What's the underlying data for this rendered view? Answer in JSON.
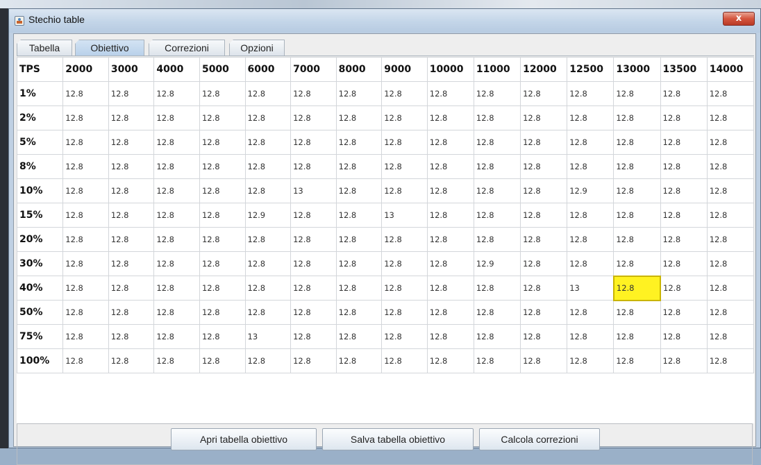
{
  "window": {
    "title": "Stechio table",
    "close_glyph": "x"
  },
  "tabs": [
    {
      "label": "Tabella",
      "selected": false
    },
    {
      "label": "Obiettivo",
      "selected": true
    },
    {
      "label": "Correzioni",
      "selected": false
    },
    {
      "label": "Opzioni",
      "selected": false
    }
  ],
  "table": {
    "corner_label": "TPS",
    "columns": [
      "2000",
      "3000",
      "4000",
      "5000",
      "6000",
      "7000",
      "8000",
      "9000",
      "10000",
      "11000",
      "12000",
      "12500",
      "13000",
      "13500",
      "14000"
    ],
    "rows": [
      {
        "label": "1%",
        "values": [
          "12.8",
          "12.8",
          "12.8",
          "12.8",
          "12.8",
          "12.8",
          "12.8",
          "12.8",
          "12.8",
          "12.8",
          "12.8",
          "12.8",
          "12.8",
          "12.8",
          "12.8"
        ]
      },
      {
        "label": "2%",
        "values": [
          "12.8",
          "12.8",
          "12.8",
          "12.8",
          "12.8",
          "12.8",
          "12.8",
          "12.8",
          "12.8",
          "12.8",
          "12.8",
          "12.8",
          "12.8",
          "12.8",
          "12.8"
        ]
      },
      {
        "label": "5%",
        "values": [
          "12.8",
          "12.8",
          "12.8",
          "12.8",
          "12.8",
          "12.8",
          "12.8",
          "12.8",
          "12.8",
          "12.8",
          "12.8",
          "12.8",
          "12.8",
          "12.8",
          "12.8"
        ]
      },
      {
        "label": "8%",
        "values": [
          "12.8",
          "12.8",
          "12.8",
          "12.8",
          "12.8",
          "12.8",
          "12.8",
          "12.8",
          "12.8",
          "12.8",
          "12.8",
          "12.8",
          "12.8",
          "12.8",
          "12.8"
        ]
      },
      {
        "label": "10%",
        "values": [
          "12.8",
          "12.8",
          "12.8",
          "12.8",
          "12.8",
          "13",
          "12.8",
          "12.8",
          "12.8",
          "12.8",
          "12.8",
          "12.9",
          "12.8",
          "12.8",
          "12.8"
        ]
      },
      {
        "label": "15%",
        "values": [
          "12.8",
          "12.8",
          "12.8",
          "12.8",
          "12.9",
          "12.8",
          "12.8",
          "13",
          "12.8",
          "12.8",
          "12.8",
          "12.8",
          "12.8",
          "12.8",
          "12.8"
        ]
      },
      {
        "label": "20%",
        "values": [
          "12.8",
          "12.8",
          "12.8",
          "12.8",
          "12.8",
          "12.8",
          "12.8",
          "12.8",
          "12.8",
          "12.8",
          "12.8",
          "12.8",
          "12.8",
          "12.8",
          "12.8"
        ]
      },
      {
        "label": "30%",
        "values": [
          "12.8",
          "12.8",
          "12.8",
          "12.8",
          "12.8",
          "12.8",
          "12.8",
          "12.8",
          "12.8",
          "12.9",
          "12.8",
          "12.8",
          "12.8",
          "12.8",
          "12.8"
        ]
      },
      {
        "label": "40%",
        "values": [
          "12.8",
          "12.8",
          "12.8",
          "12.8",
          "12.8",
          "12.8",
          "12.8",
          "12.8",
          "12.8",
          "12.8",
          "12.8",
          "13",
          "12.8",
          "12.8",
          "12.8"
        ]
      },
      {
        "label": "50%",
        "values": [
          "12.8",
          "12.8",
          "12.8",
          "12.8",
          "12.8",
          "12.8",
          "12.8",
          "12.8",
          "12.8",
          "12.8",
          "12.8",
          "12.8",
          "12.8",
          "12.8",
          "12.8"
        ]
      },
      {
        "label": "75%",
        "values": [
          "12.8",
          "12.8",
          "12.8",
          "12.8",
          "13",
          "12.8",
          "12.8",
          "12.8",
          "12.8",
          "12.8",
          "12.8",
          "12.8",
          "12.8",
          "12.8",
          "12.8"
        ]
      },
      {
        "label": "100%",
        "values": [
          "12.8",
          "12.8",
          "12.8",
          "12.8",
          "12.8",
          "12.8",
          "12.8",
          "12.8",
          "12.8",
          "12.8",
          "12.8",
          "12.8",
          "12.8",
          "12.8",
          "12.8"
        ]
      }
    ],
    "selected_cell": {
      "row": 8,
      "col": 12
    },
    "selection_color": "#fff222"
  },
  "buttons": {
    "open": "Apri tabella obiettivo",
    "save": "Salva tabella obiettivo",
    "compute": "Calcola correzioni"
  },
  "icons": {
    "app": "java-app-icon",
    "close": "close-icon"
  }
}
